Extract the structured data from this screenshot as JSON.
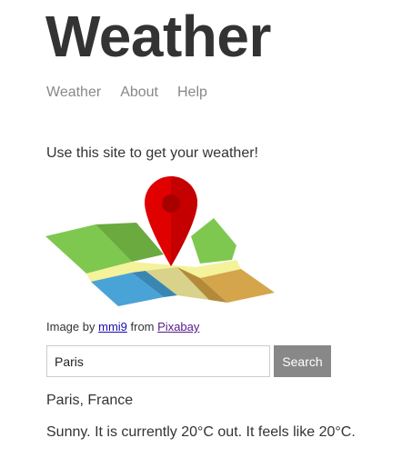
{
  "header": {
    "title": "Weather"
  },
  "nav": {
    "items": [
      "Weather",
      "About",
      "Help"
    ],
    "link_color": "#888888"
  },
  "intro": {
    "text": "Use this site to get your weather!"
  },
  "image": {
    "icon": "map-with-location-pin",
    "colors": {
      "pin": "#e00000",
      "land_green": "#7ec850",
      "water": "#4aa3d6",
      "land_orange": "#d4a54a",
      "road": "#f4f29a"
    }
  },
  "credit": {
    "prefix": "Image by",
    "author": "mmi9",
    "middle": "from",
    "source": "Pixabay"
  },
  "search": {
    "value": "Paris",
    "button_label": "Search"
  },
  "result": {
    "location": "Paris, France",
    "forecast": "Sunny. It is currently 20°C out. It feels like 20°C."
  }
}
